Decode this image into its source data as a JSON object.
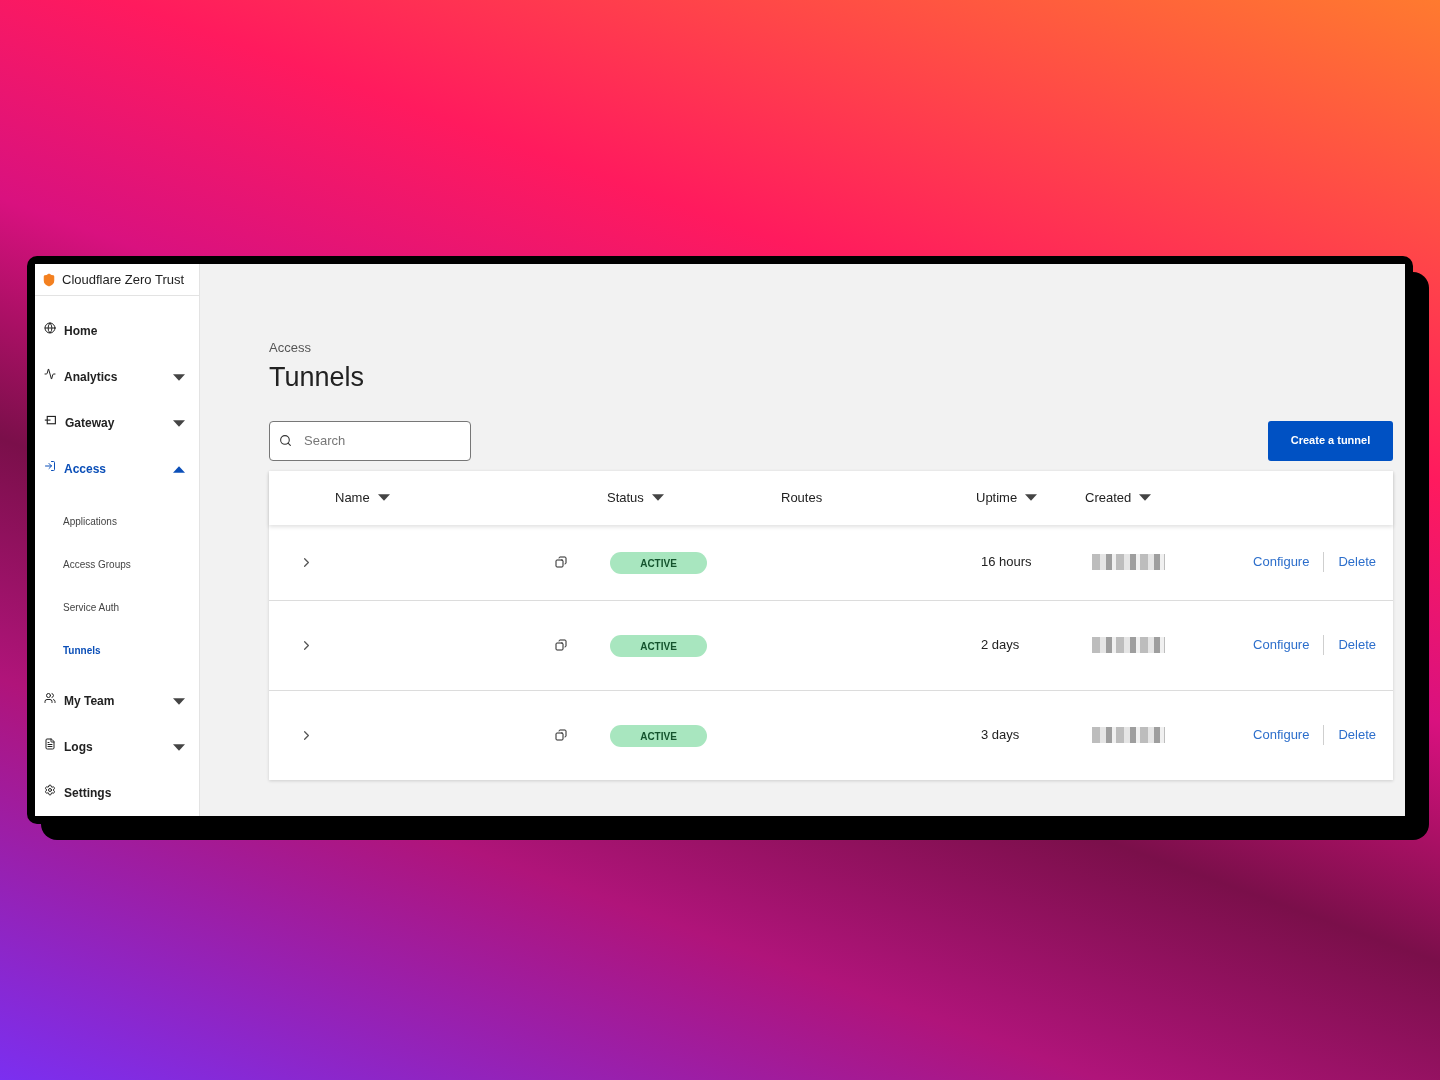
{
  "brand": "Cloudflare Zero Trust",
  "sidebar": {
    "items": [
      {
        "label": "Home",
        "selected": false
      },
      {
        "label": "Analytics",
        "selected": false,
        "expanded": false
      },
      {
        "label": "Gateway",
        "selected": false,
        "expanded": false
      },
      {
        "label": "Access",
        "selected": true,
        "expanded": true,
        "children": [
          {
            "label": "Applications",
            "selected": false
          },
          {
            "label": "Access Groups",
            "selected": false
          },
          {
            "label": "Service Auth",
            "selected": false
          },
          {
            "label": "Tunnels",
            "selected": true
          }
        ]
      },
      {
        "label": "My Team",
        "selected": false,
        "expanded": false
      },
      {
        "label": "Logs",
        "selected": false,
        "expanded": false
      },
      {
        "label": "Settings",
        "selected": false
      }
    ]
  },
  "breadcrumb": "Access",
  "title": "Tunnels",
  "search": {
    "placeholder": "Search"
  },
  "create_button": "Create a tunnel",
  "table": {
    "columns": [
      {
        "label": "Name",
        "sortable": true
      },
      {
        "label": "Status",
        "sortable": true
      },
      {
        "label": "Routes",
        "sortable": false
      },
      {
        "label": "Uptime",
        "sortable": true
      },
      {
        "label": "Created",
        "sortable": true
      }
    ],
    "rows": [
      {
        "status": "ACTIVE",
        "uptime": "16 hours",
        "actions": [
          "Configure",
          "Delete"
        ]
      },
      {
        "status": "ACTIVE",
        "uptime": "2 days",
        "actions": [
          "Configure",
          "Delete"
        ]
      },
      {
        "status": "ACTIVE",
        "uptime": "3 days",
        "actions": [
          "Configure",
          "Delete"
        ]
      }
    ]
  }
}
